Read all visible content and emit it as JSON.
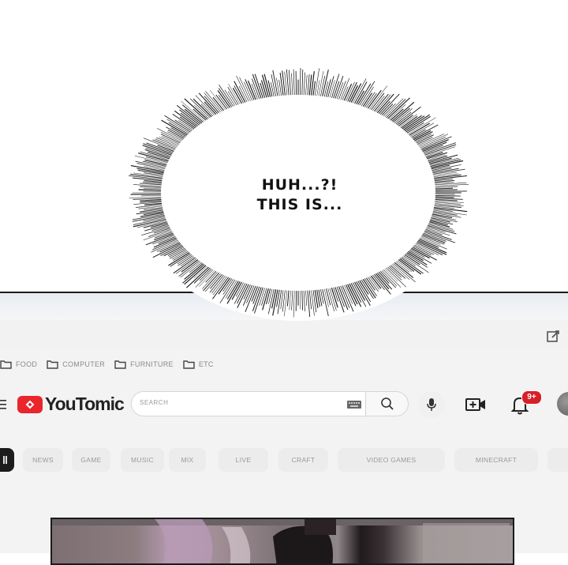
{
  "speech_bubble": {
    "line1": "HUH...?!",
    "line2": "THIS IS..."
  },
  "bookmarks": [
    {
      "label": "FOOD",
      "icon": "folder-icon"
    },
    {
      "label": "COMPUTER",
      "icon": "folder-icon"
    },
    {
      "label": "FURNITURE",
      "icon": "folder-icon"
    },
    {
      "label": "ETC",
      "icon": "folder-icon"
    }
  ],
  "header": {
    "logo_text": "YouTomic",
    "search_placeholder": "SEARCH",
    "notification_count": "9+"
  },
  "chips": [
    "NEWS",
    "GAME",
    "MUSIC",
    "MIX",
    "LIVE",
    "CRAFT",
    "VIDEO GAMES",
    "MINECRAFT"
  ],
  "colors": {
    "brand_red": "#e8262b",
    "badge_red": "#d91f26",
    "chip_background": "#ececec",
    "chip_active": "#1c1c1c"
  }
}
